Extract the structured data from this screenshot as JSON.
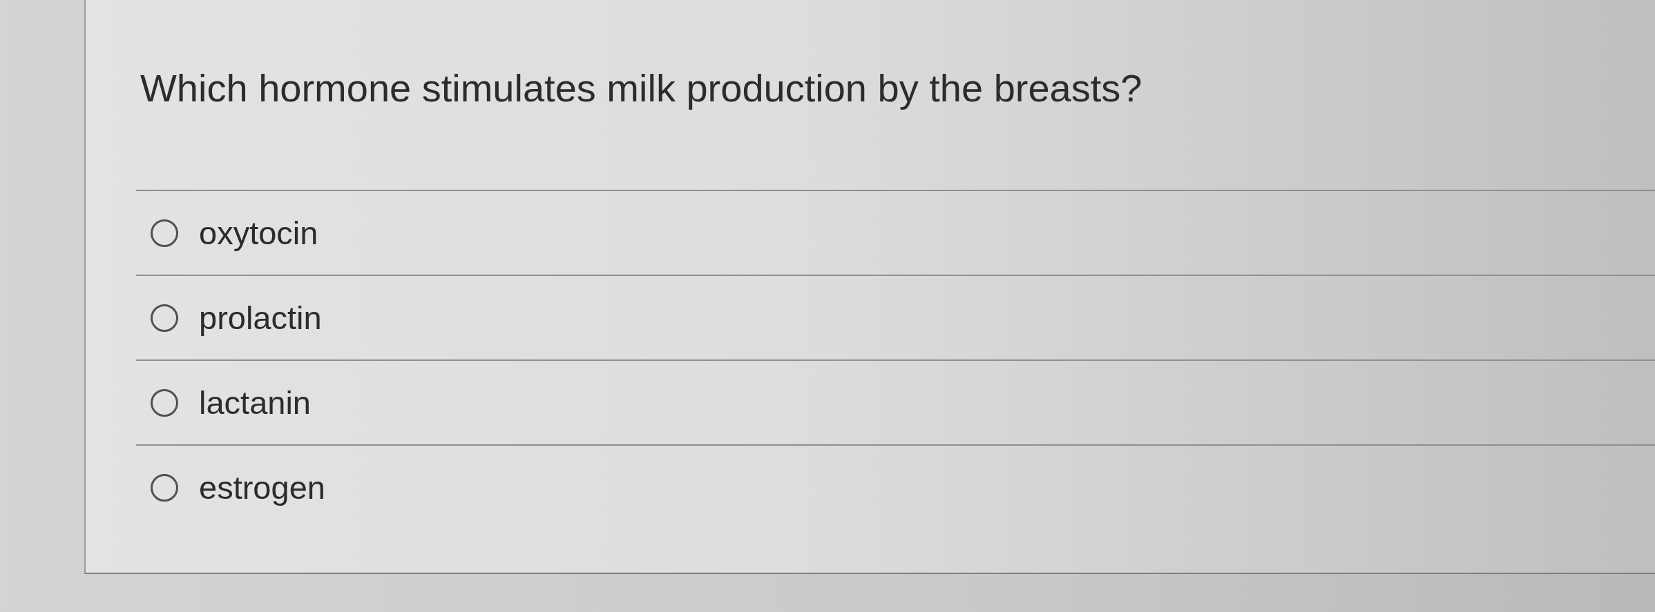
{
  "question": {
    "text": "Which hormone stimulates milk production by the breasts?"
  },
  "options": [
    {
      "label": "oxytocin",
      "selected": false
    },
    {
      "label": "prolactin",
      "selected": false
    },
    {
      "label": "lactanin",
      "selected": false
    },
    {
      "label": "estrogen",
      "selected": false
    }
  ]
}
